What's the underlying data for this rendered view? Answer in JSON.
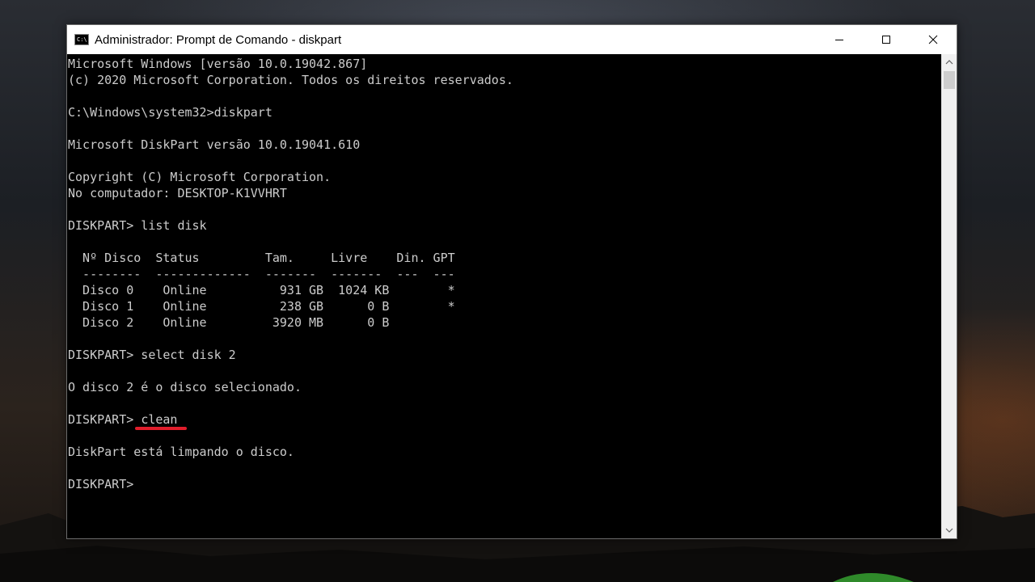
{
  "window": {
    "title": "Administrador: Prompt de Comando - diskpart",
    "icon": "cmd-icon",
    "icon_glyph": "C:\\",
    "controls": [
      "minimize-icon",
      "maximize-icon",
      "close-icon"
    ]
  },
  "console": {
    "lines": [
      "Microsoft Windows [versão 10.0.19042.867]",
      "(c) 2020 Microsoft Corporation. Todos os direitos reservados.",
      "",
      "C:\\Windows\\system32>diskpart",
      "",
      "Microsoft DiskPart versão 10.0.19041.610",
      "",
      "Copyright (C) Microsoft Corporation.",
      "No computador: DESKTOP-K1VVHRT",
      "",
      "DISKPART> list disk",
      "",
      "  Nº Disco  Status         Tam.     Livre    Din. GPT",
      "  --------  -------------  -------  -------  ---  ---",
      "  Disco 0    Online          931 GB  1024 KB        *",
      "  Disco 1    Online          238 GB      0 B        *",
      "  Disco 2    Online         3920 MB      0 B",
      "",
      "DISKPART> select disk 2",
      "",
      "O disco 2 é o disco selecionado.",
      "",
      "DISKPART> clean",
      "",
      "DiskPart está limpando o disco.",
      "",
      "DISKPART>"
    ],
    "highlight": {
      "prompt": "DISKPART> ",
      "command": "clean",
      "color": "#e11d2b"
    }
  },
  "colors": {
    "console_bg": "#000000",
    "console_text": "#cccccc",
    "titlebar_bg": "#ffffff"
  }
}
